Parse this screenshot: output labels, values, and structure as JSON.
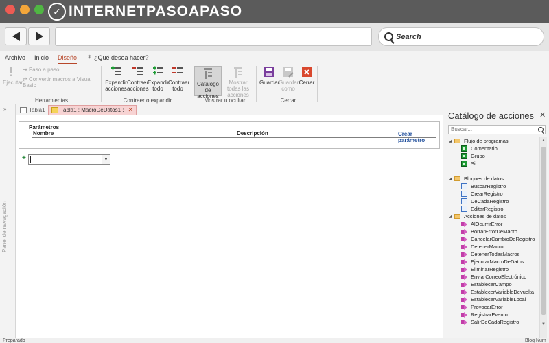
{
  "browser": {
    "logo_text": "INTERNETPASOAPASO",
    "search_label": "Search"
  },
  "ribbon": {
    "menu": [
      "Archivo",
      "Inicio",
      "Diseño",
      "¿Qué desea hacer?"
    ],
    "active_menu": "Diseño",
    "herramientas": {
      "label": "Herramientas",
      "ejecutar": "Ejecutar",
      "paso_a_paso": "Paso a paso",
      "convertir": "Convertir macros a Visual Basic"
    },
    "contraer": {
      "label": "Contraer o expandir",
      "expandir_acciones": "Expandir acciones",
      "contraer_acciones": "Contraer acciones",
      "expandir_todo": "Expandir todo",
      "contraer_todo": "Contraer todo"
    },
    "mostrar": {
      "label": "Mostrar u ocultar",
      "catalogo": "Catálogo de acciones",
      "mostrar_todas": "Mostrar todas las acciones"
    },
    "cerrar": {
      "label": "Cerrar",
      "guardar": "Guardar",
      "guardar_como": "Guardar como",
      "cerrar": "Cerrar"
    }
  },
  "nav_pane": {
    "label": "Panel de navegación"
  },
  "tabs": [
    {
      "label": "Tabla1"
    },
    {
      "label": "Tabla1 : MacroDeDatos1 :"
    }
  ],
  "parameters": {
    "title": "Parámetros",
    "col_nombre": "Nombre",
    "col_descripcion": "Descripción",
    "link": "Crear parámetro"
  },
  "catalog": {
    "title": "Catálogo de acciones",
    "search_placeholder": "Buscar...",
    "categories": [
      {
        "name": "Flujo de programas",
        "items": [
          "Comentario",
          "Grupo",
          "Si"
        ]
      },
      {
        "name": "Bloques de datos",
        "items": [
          "BuscarRegistro",
          "CrearRegistro",
          "DeCadaRegistro",
          "EditarRegistro"
        ]
      },
      {
        "name": "Acciones de datos",
        "items": [
          "AlOcurrirError",
          "BorrarErrorDeMacro",
          "CancelarCambioDeRegistro",
          "DetenerMacro",
          "DetenerTodasMacros",
          "EjecutarMacroDeDatos",
          "EliminarRegistro",
          "EnviarCorreoElectrónico",
          "EstablecerCampo",
          "EstablecerVariableDevuelta",
          "EstablecerVariableLocal",
          "ProvocarError",
          "RegistrarEvento",
          "SalirDeCadaRegistro"
        ]
      }
    ]
  },
  "status": {
    "left": "Preparado",
    "right": "Bloq Num"
  }
}
